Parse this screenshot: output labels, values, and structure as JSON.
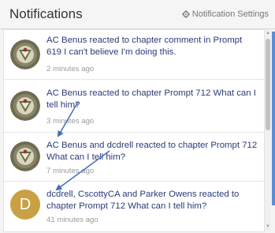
{
  "header": {
    "title": "Notifications",
    "settings_label": "Notification Settings"
  },
  "notifications": [
    {
      "text": "AC Benus reacted to chapter comment in Prompt 619 I can't believe I'm doing this.",
      "time": "2 minutes ago",
      "avatar": "pattern"
    },
    {
      "text": "AC Benus reacted to chapter Prompt 712 What can I tell him?",
      "time": "3 minutes ago",
      "avatar": "pattern"
    },
    {
      "text": "AC Benus and dcdrell reacted to chapter Prompt 712 What can I tell him?",
      "time": "7 minutes ago",
      "avatar": "pattern"
    },
    {
      "text": "dcdrell, CscottyCA and Parker Owens reacted to chapter Prompt 712 What can I tell him?",
      "time": "41 minutes ago",
      "avatar": "letter",
      "avatar_letter": "D"
    }
  ],
  "colors": {
    "link_text": "#2a3b78",
    "annotation_arrow": "#3f6fb8",
    "avatar_letter_bg": "#c9a043"
  }
}
